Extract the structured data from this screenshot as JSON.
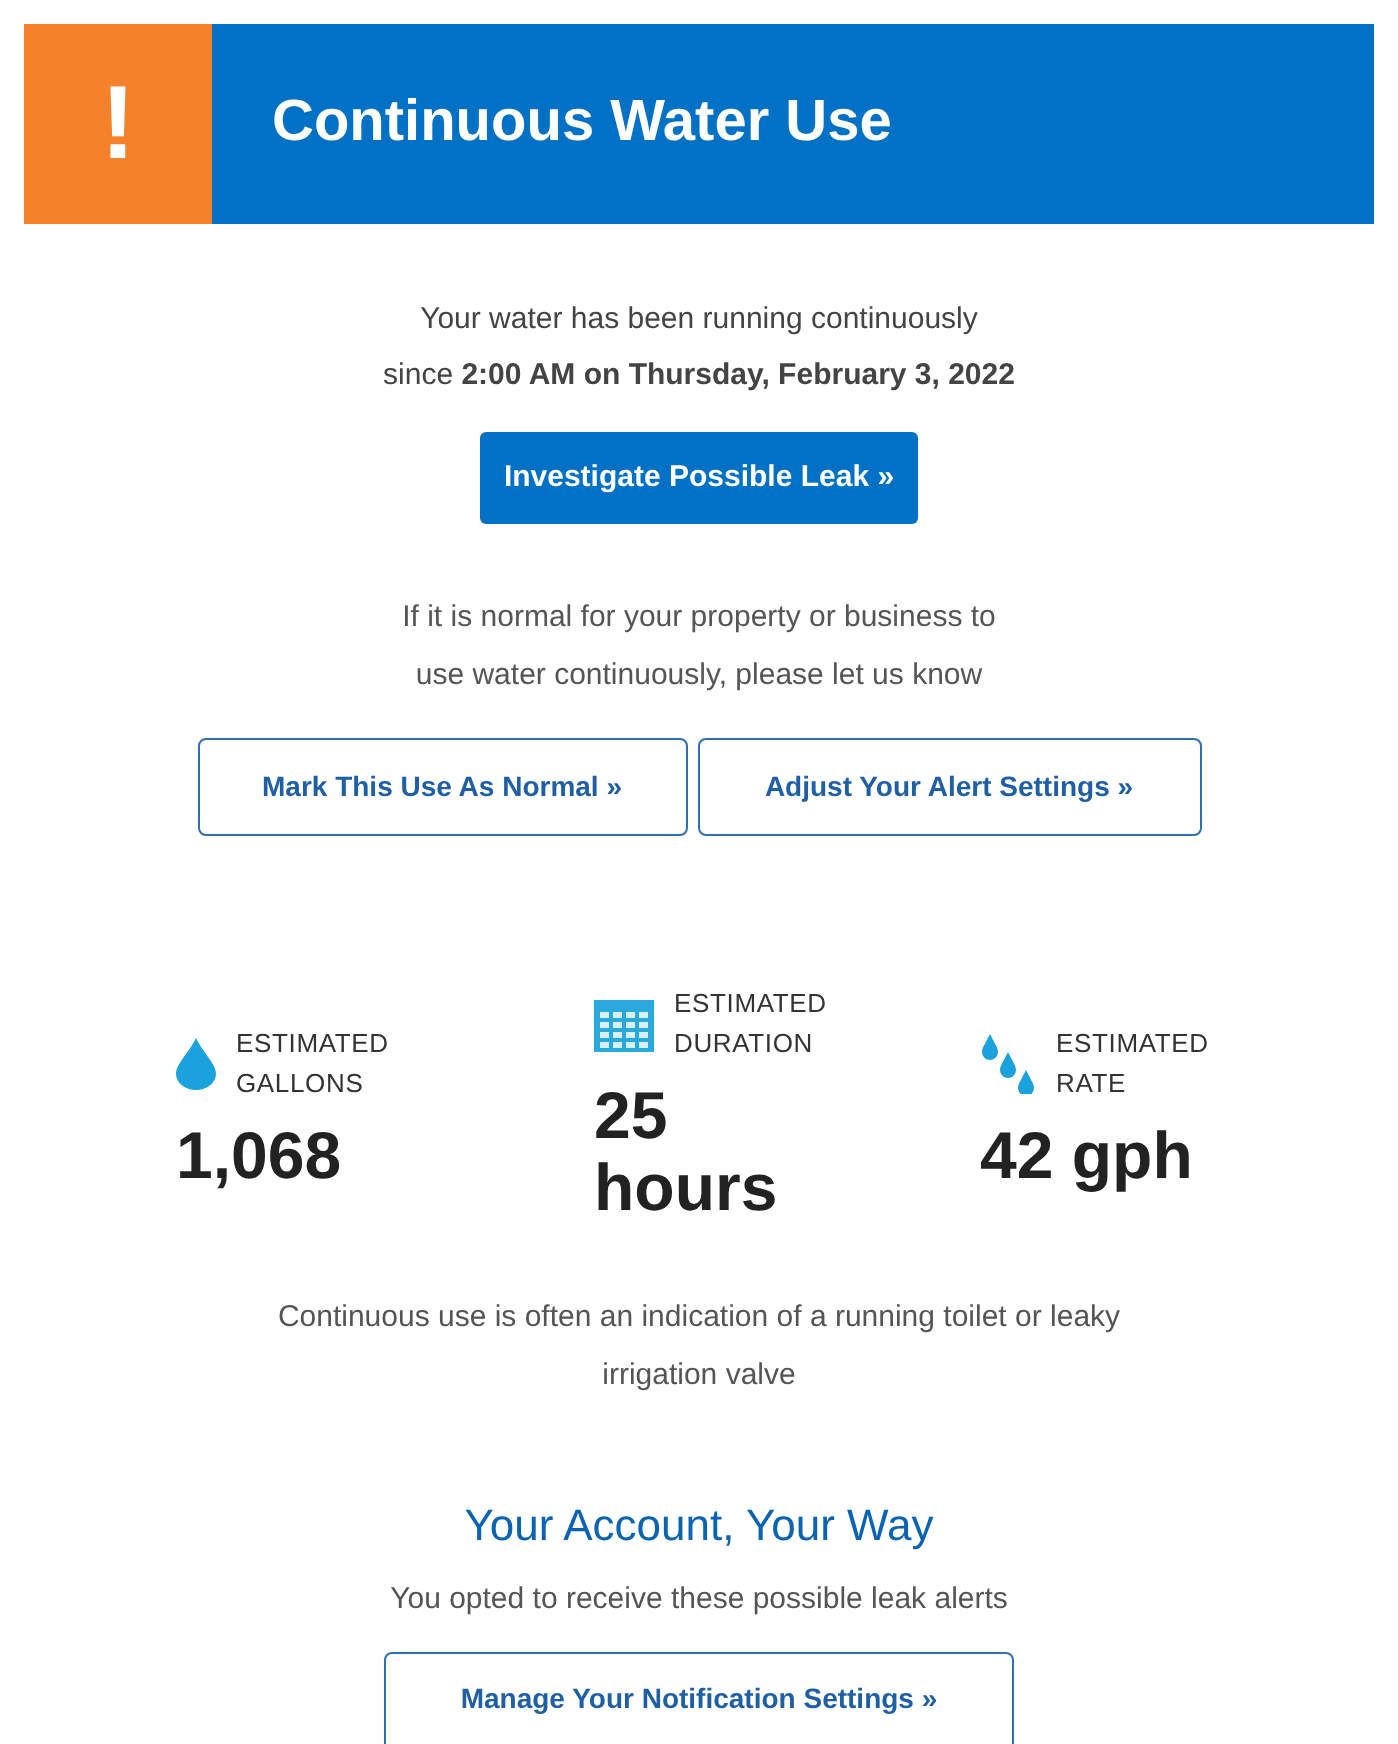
{
  "header": {
    "alert_symbol": "!",
    "title": "Continuous Water Use"
  },
  "intro": [
    "Your water has been running continuously",
    "since **2:00 AM on Thursday, February 3, 2022**"
  ],
  "primary_button": "Investigate Possible Leak »",
  "normal_note": [
    "If it is normal for your property or business to",
    "use water continuously, please let us know"
  ],
  "action_buttons": [
    "Mark This Use As Normal »",
    "Adjust Your Alert Settings »"
  ],
  "stats": [
    {
      "kind": "drop",
      "label": [
        "ESTIMATED",
        "GALLONS"
      ],
      "value": [
        "1,068"
      ]
    },
    {
      "kind": "calendar",
      "label": [
        "ESTIMATED",
        "DURATION"
      ],
      "value": [
        "25",
        "hours"
      ]
    },
    {
      "kind": "drops",
      "label": [
        "ESTIMATED",
        "RATE"
      ],
      "value": [
        "42 gph"
      ]
    }
  ],
  "hint": [
    "Continuous use is often an indication of a running toilet or leaky",
    "irrigation valve"
  ],
  "account": {
    "heading": "Your Account, Your Way",
    "text": "You opted to receive these possible leak alerts",
    "button": "Manage Your Notification Settings »"
  }
}
